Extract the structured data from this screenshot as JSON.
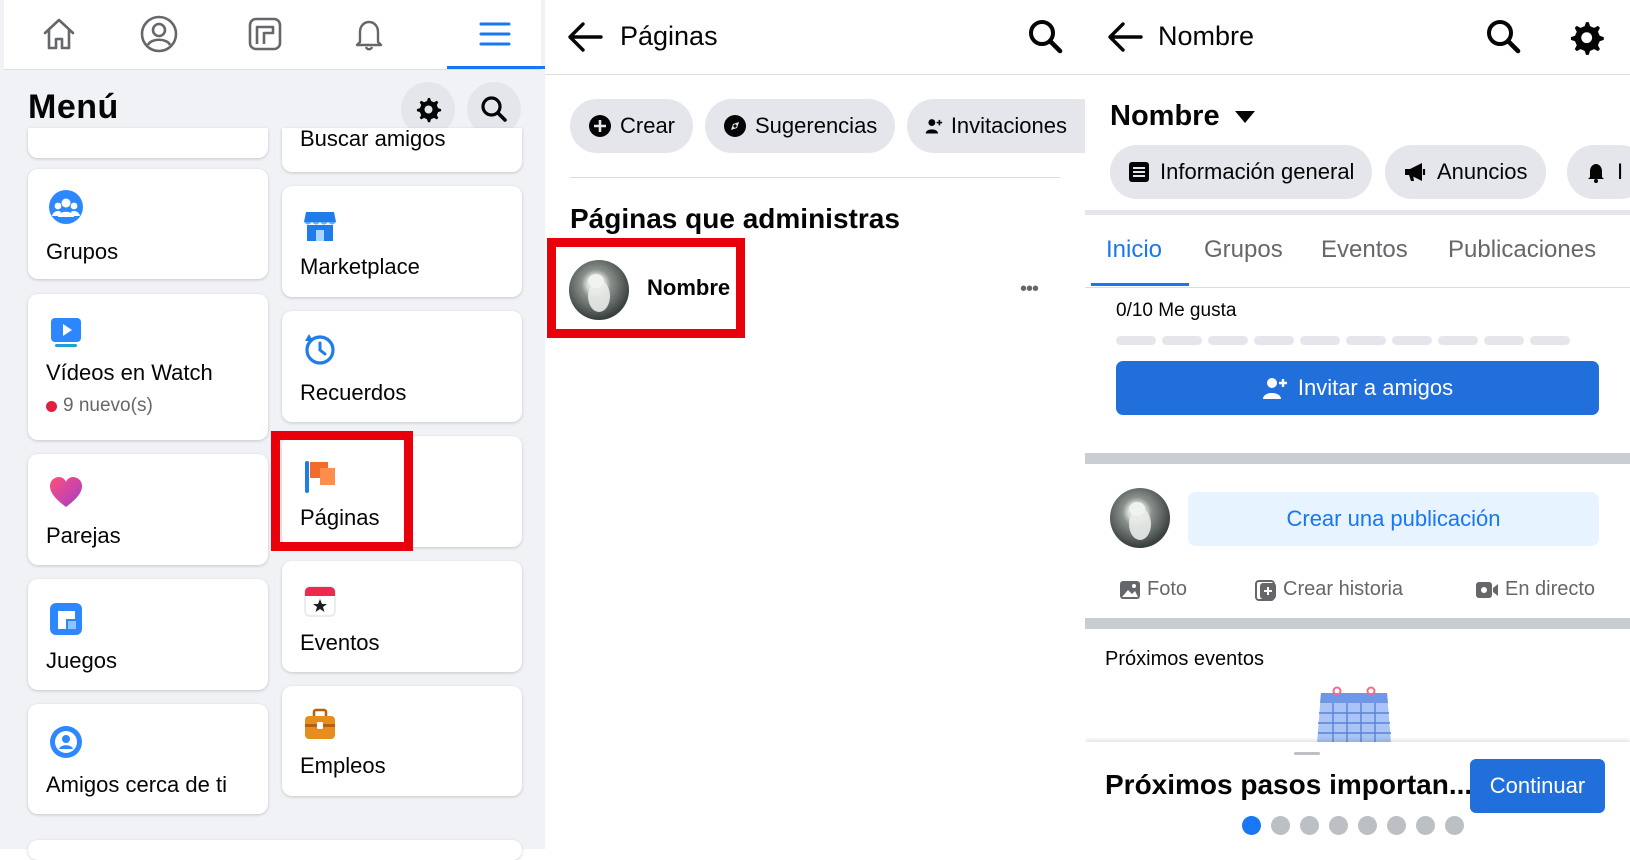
{
  "panel1": {
    "title": "Menú",
    "nav_icons": [
      "home-icon",
      "profile-icon",
      "feed-icon",
      "bell-icon",
      "menu-icon"
    ],
    "partial_top_left": "",
    "partial_top_right": "Buscar amigos",
    "left_cards": [
      {
        "label": "Grupos",
        "icon": "groups-icon"
      },
      {
        "label": "Vídeos en Watch",
        "icon": "watch-icon",
        "badge": "9 nuevo(s)"
      },
      {
        "label": "Parejas",
        "icon": "heart-icon"
      },
      {
        "label": "Juegos",
        "icon": "games-icon"
      },
      {
        "label": "Amigos cerca de ti",
        "icon": "nearby-friends-icon"
      }
    ],
    "right_cards": [
      {
        "label": "Marketplace",
        "icon": "marketplace-icon"
      },
      {
        "label": "Recuerdos",
        "icon": "memories-icon"
      },
      {
        "label": "Páginas",
        "icon": "pages-flag-icon"
      },
      {
        "label": "Eventos",
        "icon": "events-icon"
      },
      {
        "label": "Empleos",
        "icon": "jobs-icon"
      }
    ],
    "highlight_color": "#e8000b"
  },
  "panel2": {
    "title": "Páginas",
    "pills": [
      {
        "label": "Crear",
        "icon": "plus-circle-icon"
      },
      {
        "label": "Sugerencias",
        "icon": "compass-icon"
      },
      {
        "label": "Invitaciones",
        "icon": "add-person-icon"
      }
    ],
    "section_title": "Páginas que administras",
    "page_name": "Nombre",
    "more": "•••"
  },
  "panel3": {
    "header_title": "Nombre",
    "page_name": "Nombre",
    "pills": [
      {
        "label": "Información general",
        "icon": "list-icon"
      },
      {
        "label": "Anuncios",
        "icon": "megaphone-icon"
      },
      {
        "label": "I",
        "icon": "bell-icon"
      }
    ],
    "tabs": [
      "Inicio",
      "Grupos",
      "Eventos",
      "Publicaciones"
    ],
    "active_tab": "Inicio",
    "likes_text": "0/10 Me gusta",
    "likes_progress": 0,
    "invite_button": "Invitar a amigos",
    "create_post": "Crear una publicación",
    "actions": [
      {
        "label": "Foto",
        "icon": "photo-icon"
      },
      {
        "label": "Crear historia",
        "icon": "story-icon"
      },
      {
        "label": "En directo",
        "icon": "live-video-icon"
      }
    ],
    "events_title": "Próximos eventos",
    "next_steps": "Próximos pasos importan...",
    "continue_button": "Continuar",
    "pager_total": 8,
    "pager_active": 1
  },
  "colors": {
    "accent": "#1877f2",
    "button_blue": "#216fdb",
    "light_blue_bg": "#e7f3ff",
    "highlight_red": "#e8000b"
  }
}
